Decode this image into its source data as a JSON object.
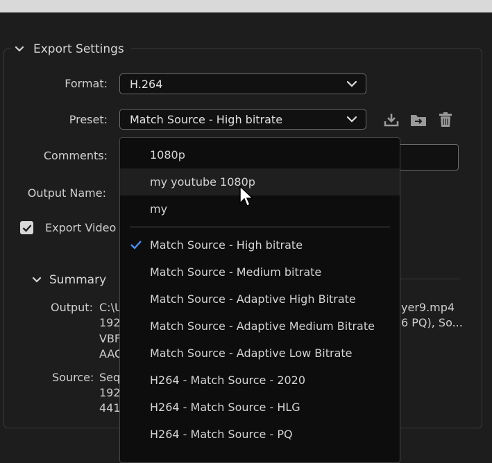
{
  "section": {
    "title": "Export Settings"
  },
  "fields": {
    "format_label": "Format:",
    "format_value": "H.264",
    "preset_label": "Preset:",
    "preset_value": "Match Source - High bitrate",
    "comments_label": "Comments:",
    "output_name_label": "Output Name:",
    "export_video_label": "Export Video",
    "export_video_checked": true
  },
  "summary": {
    "title": "Summary",
    "output_label": "Output:",
    "output_lines": [
      "C:\\U",
      "192",
      "VBF",
      "AAC"
    ],
    "output_right_lines": [
      "yer9.mp4",
      "6 PQ), So..."
    ],
    "source_label": "Source:",
    "source_lines": [
      "Seq",
      "192",
      "441"
    ]
  },
  "dropdown": {
    "items": [
      {
        "label": "1080p",
        "selected": false,
        "hover": false
      },
      {
        "label": "my youtube 1080p",
        "selected": false,
        "hover": true
      },
      {
        "label": "my",
        "selected": false,
        "hover": false
      },
      {
        "label": "Match Source - High bitrate",
        "selected": true,
        "hover": false
      },
      {
        "label": "Match Source - Medium bitrate",
        "selected": false,
        "hover": false
      },
      {
        "label": "Match Source - Adaptive High Bitrate",
        "selected": false,
        "hover": false
      },
      {
        "label": "Match Source - Adaptive Medium Bitrate",
        "selected": false,
        "hover": false
      },
      {
        "label": "Match Source - Adaptive Low Bitrate",
        "selected": false,
        "hover": false
      },
      {
        "label": "H264 - Match Source - 2020",
        "selected": false,
        "hover": false
      },
      {
        "label": "H264 - Match Source - HLG",
        "selected": false,
        "hover": false
      },
      {
        "label": "H264 - Match Source - PQ",
        "selected": false,
        "hover": false
      }
    ]
  },
  "icons": {
    "save_preset": "download-icon",
    "import_preset": "folder-import-icon",
    "delete_preset": "trash-icon"
  },
  "colors": {
    "accent": "#4f8ef7",
    "background": "#1d1d1d",
    "menu_bg": "#0d0d0d"
  }
}
